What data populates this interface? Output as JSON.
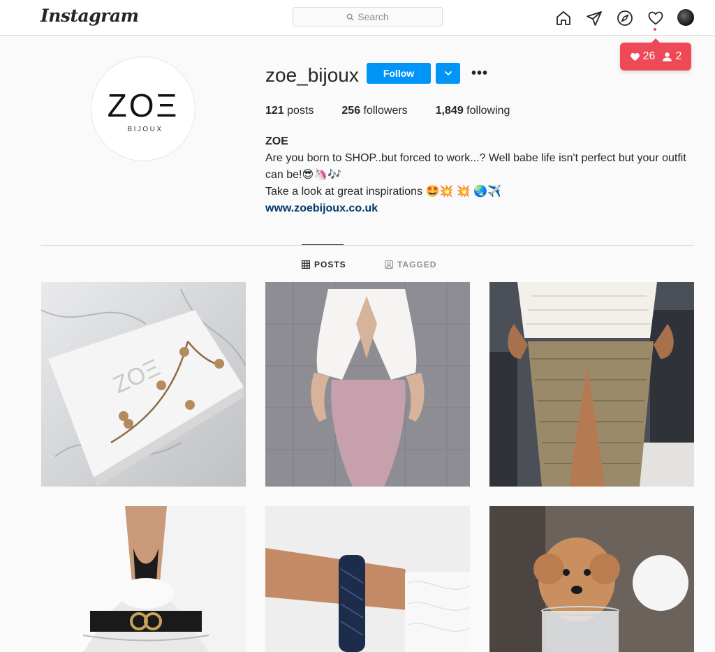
{
  "nav": {
    "logo": "Instagram",
    "search_placeholder": "Search",
    "icons": [
      "home-icon",
      "direct-icon",
      "explore-icon",
      "activity-heart-icon",
      "profile-avatar"
    ]
  },
  "notifications": {
    "likes": "26",
    "follows": "2",
    "color": "#ed4956"
  },
  "profile": {
    "avatar_main": "ZOΞ",
    "avatar_sub": "BIJOUX",
    "username": "zoe_bijoux",
    "follow_label": "Follow",
    "more_label": "•••",
    "stats": {
      "posts_count": "121",
      "posts_label": " posts",
      "followers_count": "256",
      "followers_label": " followers",
      "following_count": "1,849",
      "following_label": " following"
    },
    "bio": {
      "name": "ZOE",
      "line1": "Are you born to SHOP..but forced to work...? Well babe life isn't perfect but your outfit can be!😎🦄🎶",
      "line2": "Take a look at great inspirations 🤩💥 💥 🌏✈️",
      "link": "www.zoebijoux.co.uk"
    }
  },
  "tabs": {
    "posts": "POSTS",
    "tagged": "TAGGED"
  },
  "posts": [
    {
      "subject": "marble box with heart necklace"
    },
    {
      "subject": "white blouse and pink pencil skirt"
    },
    {
      "subject": "crochet top and beaded skirt runway"
    },
    {
      "subject": "white knit top with gucci belt"
    },
    {
      "subject": "braided navy bracelet on wrist"
    },
    {
      "subject": "apricot poodle puppy in glass"
    }
  ],
  "colors": {
    "accent": "#0095f6",
    "link": "#00376b",
    "border": "#dbdbdb",
    "muted": "#8e8e8e"
  }
}
